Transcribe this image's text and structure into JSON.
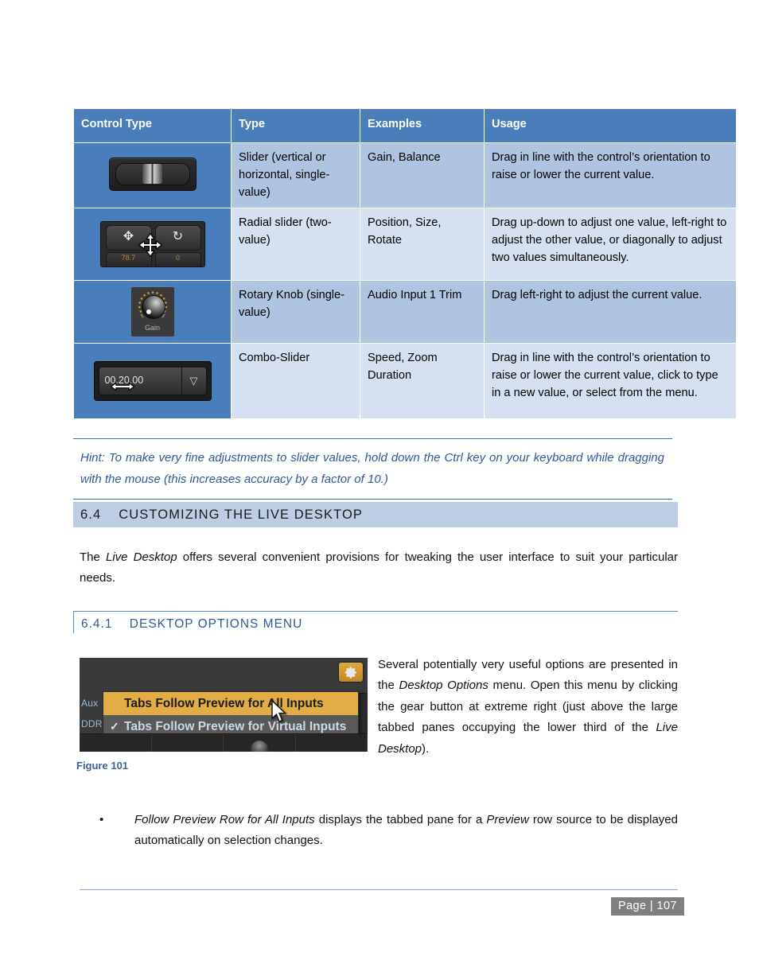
{
  "table": {
    "headers": [
      "Control Type",
      "Type",
      "Examples",
      "Usage"
    ],
    "rows": [
      {
        "control_art": "horizontal-slider",
        "type": "Slider (vertical or horizontal, single-value)",
        "examples": "Gain, Balance",
        "usage": "Drag in line with the control’s orientation to raise or lower the current value."
      },
      {
        "control_art": "radial-slider",
        "type": "Radial slider (two-value)",
        "examples": "Position, Size, Rotate",
        "usage": "Drag up-down to adjust one value, left-right to adjust the other value, or diagonally to adjust two values simultaneously."
      },
      {
        "control_art": "rotary-knob",
        "knob_label": "Gain",
        "type": "Rotary Knob (single-value)",
        "examples": "Audio Input 1 Trim",
        "usage": "Drag left-right to adjust the current value."
      },
      {
        "control_art": "combo-slider",
        "combo_value": "00.20.00",
        "type": "Combo-Slider",
        "examples": "Speed, Zoom Duration",
        "usage": "Drag in line with the control’s orientation to raise or lower the current value, click to type in a new value, or select from the menu."
      }
    ]
  },
  "hint": {
    "text": "Hint: To make very fine adjustments to slider values, hold down the Ctrl key on your keyboard while dragging with the mouse (this increases accuracy by a factor of 10.)"
  },
  "heading_h2": {
    "number": "6.4",
    "title": "CUSTOMIZING THE LIVE DESKTOP"
  },
  "intro_paragraph": {
    "part1": "The ",
    "italic1": "Live Desktop",
    "part2": " offers several convenient provisions for tweaking the user interface to suit your particular needs."
  },
  "heading_h3": {
    "number": "6.4.1",
    "title": "DESKTOP OPTIONS MENU"
  },
  "figure": {
    "caption": "Figure 101",
    "gear_icon": "gear-icon",
    "left_tabs": [
      "Aux",
      "DDR"
    ],
    "menu_items": [
      {
        "label": "Tabs Follow Preview for All Inputs",
        "checked": false,
        "highlighted": true
      },
      {
        "label": "Tabs Follow Preview for Virtual Inputs",
        "checked": true,
        "highlighted": false
      }
    ],
    "check_glyph": "✓",
    "cursor": "mouse-pointer-icon",
    "colors": {
      "highlight": "#e2ad45",
      "menu_bg": "#595959",
      "panel": "#3a3a3a"
    }
  },
  "figure_paragraph": {
    "part1": "Several potentially very useful options are presented in the ",
    "italic1": "Desktop Options",
    "part2": " menu.  Open this menu by clicking the gear button at extreme right (just above the large tabbed panes occupying the lower third of the ",
    "italic2": "Live Desktop",
    "part3": ")."
  },
  "bullet": {
    "marker": "•",
    "italic1": "Follow Preview Row for All Inputs",
    "part1": " displays the tabbed pane for a ",
    "italic2": "Preview",
    "part2": " row source to be displayed automatically on selection changes."
  },
  "footer": {
    "page_label": "Page  |  107"
  },
  "colors": {
    "table_header_bg": "#4a7ebb",
    "table_row_a": "#aec4e0",
    "table_row_b": "#d5e0f0",
    "heading_accent": "#2e5b96",
    "h2_bar_bg": "#bdcee4",
    "page_badge_bg": "#7f7f7f"
  }
}
